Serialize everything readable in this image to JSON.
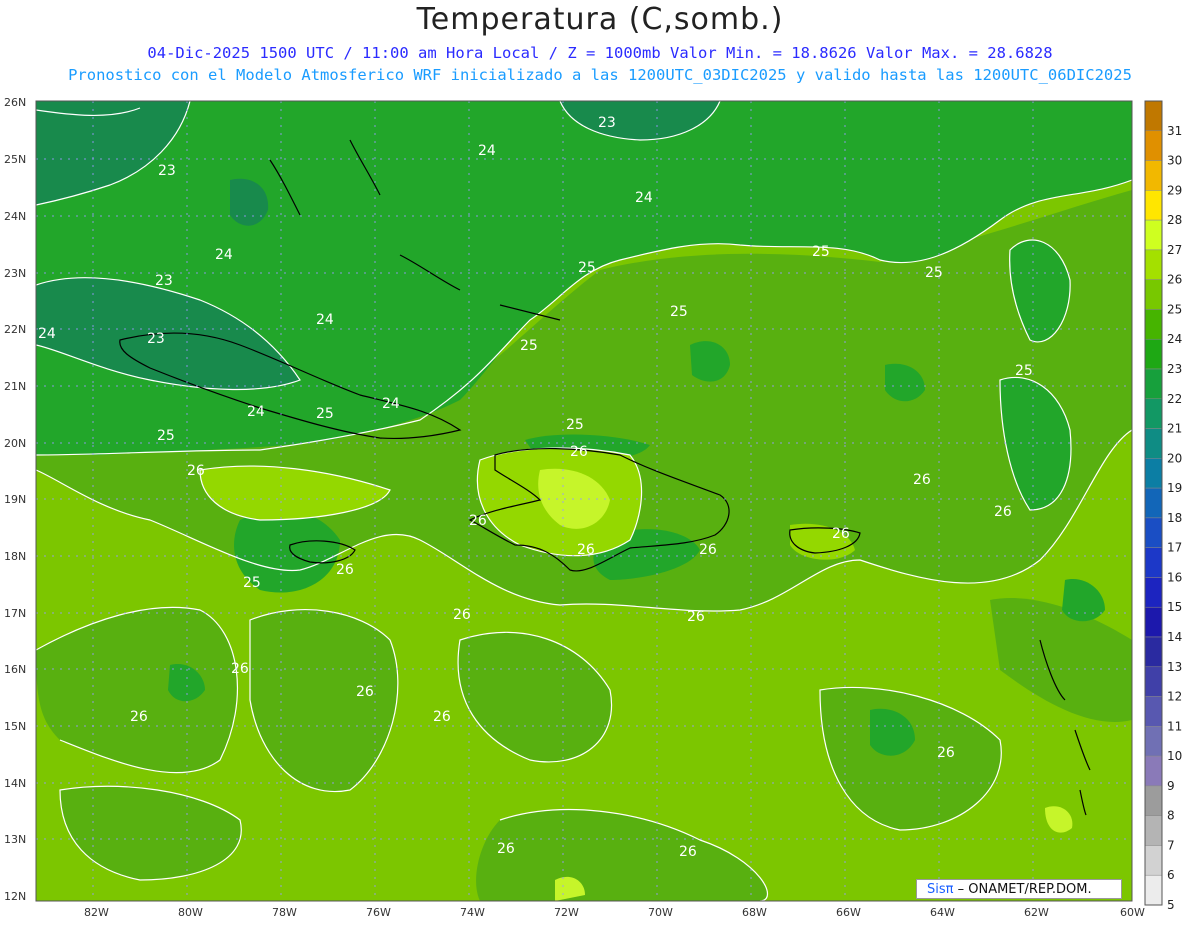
{
  "title": "Temperatura (C,somb.)",
  "subtitle_line1": "04-Dic-2025 1500 UTC / 11:00 am Hora Local / Z = 1000mb  Valor Min. = 18.8626  Valor Max. = 28.6828",
  "subtitle_line2": "Pronostico con el Modelo Atmosferico WRF inicializado a las 1200UTC_03DIC2025 y valido hasta las  1200UTC_06DIC2025",
  "credit": {
    "brand": "Sisπ",
    "text": "– ONAMET/REP.DOM."
  },
  "lat_labels": [
    "26N",
    "25N",
    "24N",
    "23N",
    "22N",
    "21N",
    "20N",
    "19N",
    "18N",
    "17N",
    "16N",
    "15N",
    "14N",
    "13N",
    "12N"
  ],
  "lon_labels": [
    "82W",
    "80W",
    "78W",
    "76W",
    "74W",
    "72W",
    "70W",
    "68W",
    "66W",
    "64W",
    "62W",
    "60W"
  ],
  "colorbar": {
    "levels": [
      "31",
      "30",
      "29",
      "28",
      "27",
      "26",
      "25",
      "24",
      "23",
      "22",
      "21",
      "20",
      "19",
      "18",
      "17",
      "16",
      "15",
      "14",
      "13",
      "12",
      "11",
      "10",
      "9",
      "8",
      "7",
      "6",
      "5"
    ],
    "colors": [
      "#c07800",
      "#e09000",
      "#f2b800",
      "#ffe600",
      "#cfff20",
      "#a4e000",
      "#78c800",
      "#46b400",
      "#1ea814",
      "#17a03c",
      "#129864",
      "#0f8c84",
      "#0c7ea4",
      "#1266b8",
      "#1a4ec4",
      "#1c38c8",
      "#1c24c0",
      "#1c18ac",
      "#2a2aa0",
      "#4040a8",
      "#5858b0",
      "#7070b4",
      "#8a7ab8",
      "#9c9c9c",
      "#b4b4b4",
      "#d2d2d2",
      "#ececec"
    ]
  },
  "contour_labels": [
    "23",
    "24",
    "24",
    "23",
    "24",
    "23",
    "24",
    "24",
    "23",
    "24",
    "25",
    "24",
    "25",
    "25",
    "25",
    "25",
    "25",
    "25",
    "25",
    "25",
    "26",
    "26",
    "26",
    "26",
    "26",
    "26",
    "26",
    "26",
    "26",
    "26",
    "26",
    "26",
    "26",
    "26",
    "26",
    "26",
    "25",
    "26"
  ],
  "zone_colors": {
    "c23": "#1a8a4a",
    "c24": "#23a62a",
    "c25": "#55b010",
    "c26": "#7cc600",
    "c27": "#92d800",
    "c28": "#c6f52a"
  }
}
